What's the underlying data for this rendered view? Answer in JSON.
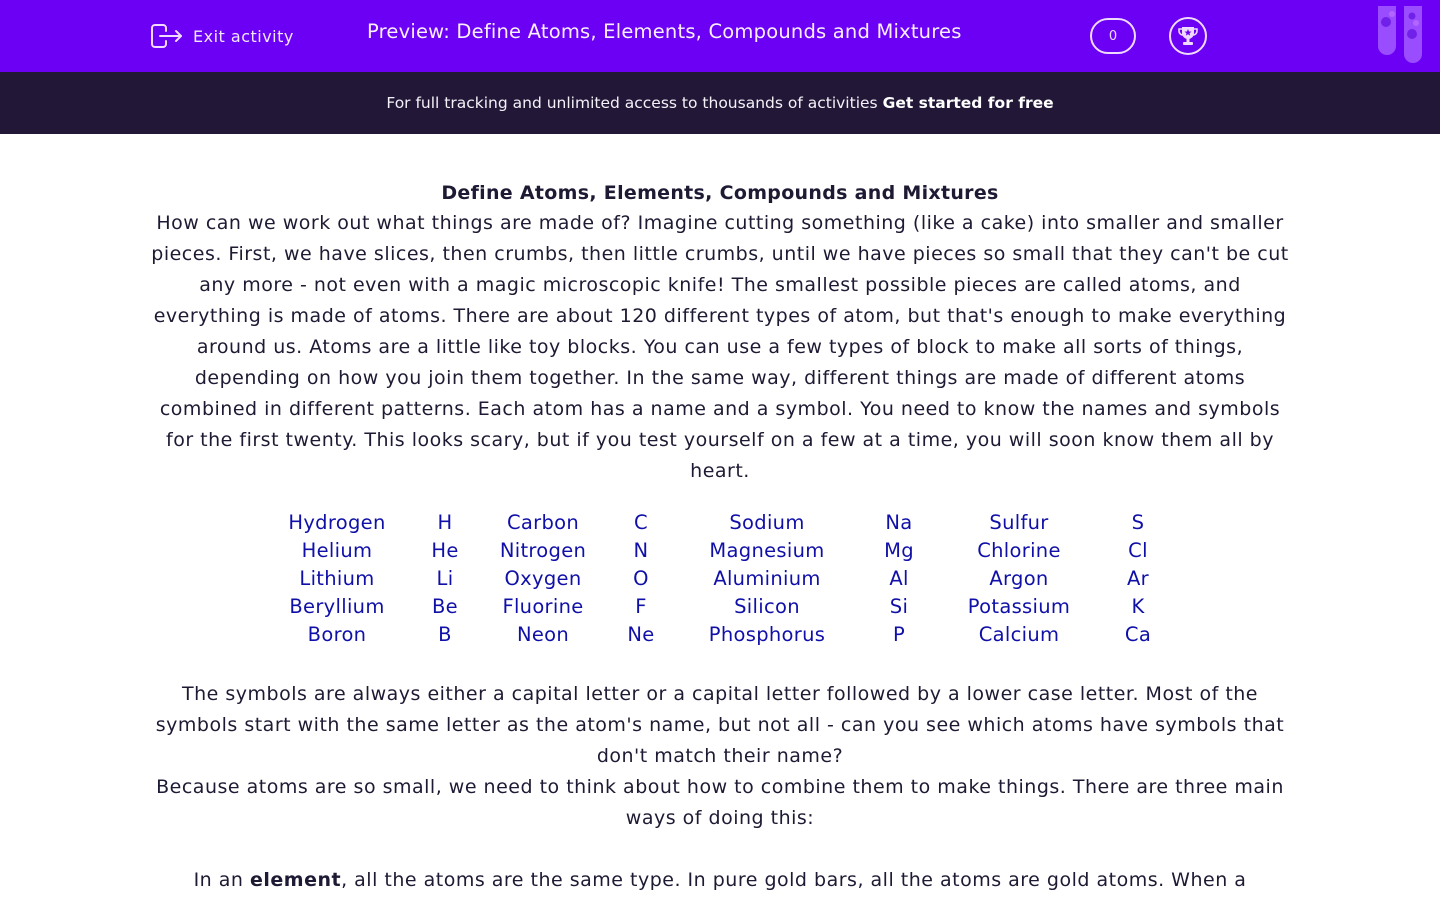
{
  "topbar": {
    "exit_label": "Exit activity",
    "title": "Preview: Define Atoms, Elements, Compounds and Mixtures",
    "score": "0",
    "background_color": "#6b00f5"
  },
  "banner": {
    "text": "For full tracking and unlimited access to thousands of activities",
    "cta": "Get started for free",
    "background_color": "#221737"
  },
  "content": {
    "heading": "Define Atoms, Elements, Compounds and Mixtures",
    "intro": "How can we work out what things are made of? Imagine cutting something (like a cake) into smaller and smaller pieces. First, we have slices, then crumbs, then little crumbs, until we have pieces so small that they can't be cut any more - not even with a magic microscopic knife! The smallest possible pieces are called atoms, and everything is made of atoms. There are about 120 different types of atom, but that's enough to make everything around us. Atoms are a little like toy blocks. You can use a few types of block to make all sorts of things, depending on how you join them together. In the same way, different things are made of different atoms combined in different patterns. Each atom has a name and a symbol. You need to know the names and symbols for the first twenty. This looks scary, but if you test yourself on a few at a time, you will soon know them all by heart.",
    "element_color": "#1010a8",
    "element_groups": [
      {
        "names": [
          "Hydrogen",
          "Helium",
          "Lithium",
          "Beryllium",
          "Boron"
        ],
        "symbols": [
          "H",
          "He",
          "Li",
          "Be",
          "B"
        ]
      },
      {
        "names": [
          "Carbon",
          "Nitrogen",
          "Oxygen",
          "Fluorine",
          "Neon"
        ],
        "symbols": [
          "C",
          "N",
          "O",
          "F",
          "Ne"
        ]
      },
      {
        "names": [
          "Sodium",
          "Magnesium",
          "Aluminium",
          "Silicon",
          "Phosphorus"
        ],
        "symbols": [
          "Na",
          "Mg",
          "Al",
          "Si",
          "P"
        ]
      },
      {
        "names": [
          "Sulfur",
          "Chlorine",
          "Argon",
          "Potassium",
          "Calcium"
        ],
        "symbols": [
          "S",
          "Cl",
          "Ar",
          "K",
          "Ca"
        ]
      }
    ],
    "symbols_note": "The symbols are always either a capital letter or a capital letter followed by a lower case letter. Most of the symbols start with the same letter as the atom's name, but not all - can you see which atoms have symbols that don't match their name?",
    "combine_note": "Because atoms are so small, we need to think about how to combine them to make things. There are three main ways of doing this:",
    "element_para": {
      "prefix": "In an ",
      "bold": "element",
      "suffix": ", all the atoms are the same type. In pure gold bars, all the atoms are gold atoms. When a"
    }
  }
}
